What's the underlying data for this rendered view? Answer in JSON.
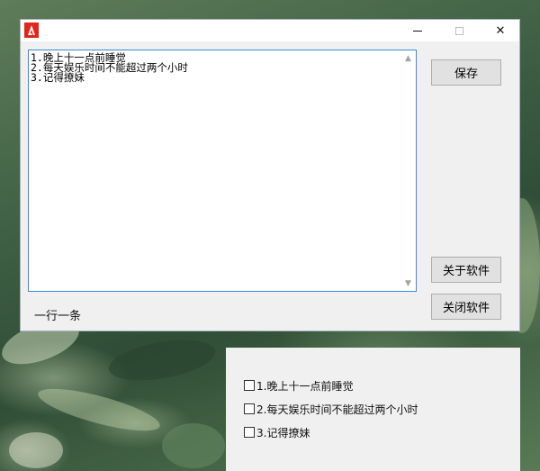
{
  "window": {
    "icon": "adobe-logo-icon",
    "min_icon": "minimize-icon",
    "max_icon": "maximize-icon",
    "close_glyph": "✕"
  },
  "editor": {
    "lines": [
      "1.晚上十一点前睡觉",
      "2.每天娱乐时间不能超过两个小时",
      "3.记得撩妹"
    ]
  },
  "buttons": {
    "save": "保存",
    "about": "关于软件",
    "close": "关闭软件"
  },
  "hint": "一行一条",
  "checklist": [
    {
      "label": "1.晚上十一点前睡觉",
      "checked": false
    },
    {
      "label": "2.每天娱乐时间不能超过两个小时",
      "checked": false
    },
    {
      "label": "3.记得撩妹",
      "checked": false
    }
  ],
  "colors": {
    "editor_border": "#3c8ad6",
    "window_bg": "#f0f0f0",
    "adobe_red": "#e1251b"
  }
}
